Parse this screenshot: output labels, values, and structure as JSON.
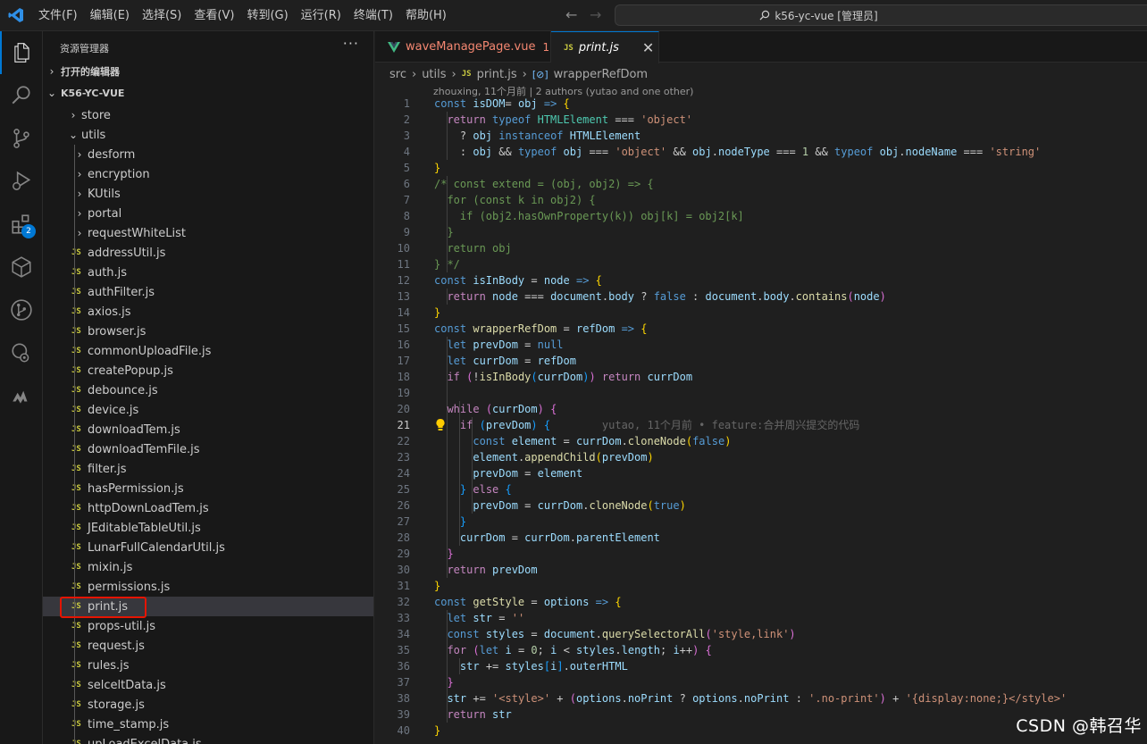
{
  "titlebar": {
    "menus": [
      "文件(F)",
      "编辑(E)",
      "选择(S)",
      "查看(V)",
      "转到(G)",
      "运行(R)",
      "终端(T)",
      "帮助(H)"
    ],
    "search_text": "k56-yc-vue [管理员]"
  },
  "activitybar": {
    "extensions_badge": "2",
    "icons": [
      "explorer-icon",
      "search-icon",
      "source-control-icon",
      "run-debug-icon",
      "extensions-icon",
      "box-icon",
      "git-graph-icon",
      "remote-icon",
      "logo-icon"
    ]
  },
  "sidebar": {
    "title": "资源管理器",
    "more": "···",
    "open_editors": "打开的编辑器",
    "project": "K56-YC-VUE",
    "items": [
      {
        "label": "store",
        "type": "folder",
        "state": "closed",
        "level": 1
      },
      {
        "label": "utils",
        "type": "folder",
        "state": "open",
        "level": 1
      },
      {
        "label": "desform",
        "type": "folder",
        "state": "closed",
        "level": 2
      },
      {
        "label": "encryption",
        "type": "folder",
        "state": "closed",
        "level": 2
      },
      {
        "label": "KUtils",
        "type": "folder",
        "state": "closed",
        "level": 2
      },
      {
        "label": "portal",
        "type": "folder",
        "state": "closed",
        "level": 2
      },
      {
        "label": "requestWhiteList",
        "type": "folder",
        "state": "closed",
        "level": 2
      },
      {
        "label": "addressUtil.js",
        "type": "js",
        "level": 2
      },
      {
        "label": "auth.js",
        "type": "js",
        "level": 2
      },
      {
        "label": "authFilter.js",
        "type": "js",
        "level": 2
      },
      {
        "label": "axios.js",
        "type": "js",
        "level": 2
      },
      {
        "label": "browser.js",
        "type": "js",
        "level": 2
      },
      {
        "label": "commonUploadFile.js",
        "type": "js",
        "level": 2
      },
      {
        "label": "createPopup.js",
        "type": "js",
        "level": 2
      },
      {
        "label": "debounce.js",
        "type": "js",
        "level": 2
      },
      {
        "label": "device.js",
        "type": "js",
        "level": 2
      },
      {
        "label": "downloadTem.js",
        "type": "js",
        "level": 2
      },
      {
        "label": "downloadTemFile.js",
        "type": "js",
        "level": 2
      },
      {
        "label": "filter.js",
        "type": "js",
        "level": 2
      },
      {
        "label": "hasPermission.js",
        "type": "js",
        "level": 2
      },
      {
        "label": "httpDownLoadTem.js",
        "type": "js",
        "level": 2
      },
      {
        "label": "JEditableTableUtil.js",
        "type": "js",
        "level": 2
      },
      {
        "label": "LunarFullCalendarUtil.js",
        "type": "js",
        "level": 2
      },
      {
        "label": "mixin.js",
        "type": "js",
        "level": 2
      },
      {
        "label": "permissions.js",
        "type": "js",
        "level": 2
      },
      {
        "label": "print.js",
        "type": "js",
        "level": 2,
        "selected": true
      },
      {
        "label": "props-util.js",
        "type": "js",
        "level": 2
      },
      {
        "label": "request.js",
        "type": "js",
        "level": 2
      },
      {
        "label": "rules.js",
        "type": "js",
        "level": 2
      },
      {
        "label": "selceltData.js",
        "type": "js",
        "level": 2
      },
      {
        "label": "storage.js",
        "type": "js",
        "level": 2
      },
      {
        "label": "time_stamp.js",
        "type": "js",
        "level": 2
      },
      {
        "label": "upLoadExcelData.js",
        "type": "js",
        "level": 2
      }
    ]
  },
  "tabs": [
    {
      "label": "waveManagePage.vue",
      "modified": "1"
    },
    {
      "label": "print.js",
      "close": "✕"
    }
  ],
  "breadcrumb": {
    "parts": [
      "src",
      "utils",
      "print.js",
      "wrapperRefDom"
    ],
    "sep": "›"
  },
  "codelens": "zhouxing, 11个月前 | 2 authors (yutao and one other)",
  "blame": "yutao, 11个月前 • feature:合并周兴提交的代码",
  "current_line": 21,
  "code_lines": [
    [
      [
        "k",
        "const "
      ],
      [
        "v",
        "isDOM"
      ],
      [
        "",
        "="
      ],
      [
        "v",
        " obj"
      ],
      [
        "",
        " "
      ],
      [
        "k",
        "=>"
      ],
      [
        "",
        " "
      ],
      [
        "y",
        "{"
      ]
    ],
    [
      [
        "",
        "  "
      ],
      [
        "c",
        "return "
      ],
      [
        "k",
        "typeof "
      ],
      [
        "t",
        "HTMLElement"
      ],
      [
        "",
        " === "
      ],
      [
        "s",
        "'object'"
      ]
    ],
    [
      [
        "",
        "    ? "
      ],
      [
        "v",
        "obj"
      ],
      [
        "",
        " "
      ],
      [
        "k",
        "instanceof "
      ],
      [
        "v",
        "HTMLElement"
      ]
    ],
    [
      [
        "",
        "    : "
      ],
      [
        "v",
        "obj"
      ],
      [
        "",
        " && "
      ],
      [
        "k",
        "typeof "
      ],
      [
        "v",
        "obj"
      ],
      [
        "",
        " === "
      ],
      [
        "s",
        "'object'"
      ],
      [
        "",
        " && "
      ],
      [
        "v",
        "obj"
      ],
      [
        "",
        "."
      ],
      [
        "v",
        "nodeType"
      ],
      [
        "",
        " === "
      ],
      [
        "n",
        "1"
      ],
      [
        "",
        " && "
      ],
      [
        "k",
        "typeof "
      ],
      [
        "v",
        "obj"
      ],
      [
        "",
        "."
      ],
      [
        "v",
        "nodeName"
      ],
      [
        "",
        " === "
      ],
      [
        "s",
        "'string'"
      ]
    ],
    [
      [
        "y",
        "}"
      ]
    ],
    [
      [
        "cm",
        "/* const extend = (obj, obj2) => {"
      ]
    ],
    [
      [
        "cm",
        "  for (const k in obj2) {"
      ]
    ],
    [
      [
        "cm",
        "    if (obj2.hasOwnProperty(k)) obj[k] = obj2[k]"
      ]
    ],
    [
      [
        "cm",
        "  }"
      ]
    ],
    [
      [
        "cm",
        "  return obj"
      ]
    ],
    [
      [
        "cm",
        "} */"
      ]
    ],
    [
      [
        "k",
        "const "
      ],
      [
        "v",
        "isInBody"
      ],
      [
        "",
        " = "
      ],
      [
        "v",
        "node"
      ],
      [
        "",
        " "
      ],
      [
        "k",
        "=>"
      ],
      [
        "",
        " "
      ],
      [
        "y",
        "{"
      ]
    ],
    [
      [
        "",
        "  "
      ],
      [
        "c",
        "return "
      ],
      [
        "v",
        "node"
      ],
      [
        "",
        " === "
      ],
      [
        "v",
        "document"
      ],
      [
        "",
        "."
      ],
      [
        "v",
        "body"
      ],
      [
        "",
        " ? "
      ],
      [
        "k",
        "false"
      ],
      [
        "",
        " : "
      ],
      [
        "v",
        "document"
      ],
      [
        "",
        "."
      ],
      [
        "v",
        "body"
      ],
      [
        "",
        "."
      ],
      [
        "f",
        "contains"
      ],
      [
        "p",
        "("
      ],
      [
        "v",
        "node"
      ],
      [
        "p",
        ")"
      ]
    ],
    [
      [
        "y",
        "}"
      ]
    ],
    [
      [
        "k",
        "const "
      ],
      [
        "f",
        "wrapperRefDom"
      ],
      [
        "",
        " = "
      ],
      [
        "v",
        "refDom"
      ],
      [
        "",
        " "
      ],
      [
        "k",
        "=>"
      ],
      [
        "",
        " "
      ],
      [
        "y",
        "{"
      ]
    ],
    [
      [
        "",
        "  "
      ],
      [
        "k",
        "let "
      ],
      [
        "v",
        "prevDom"
      ],
      [
        "",
        " = "
      ],
      [
        "k",
        "null"
      ]
    ],
    [
      [
        "",
        "  "
      ],
      [
        "k",
        "let "
      ],
      [
        "v",
        "currDom"
      ],
      [
        "",
        " = "
      ],
      [
        "v",
        "refDom"
      ]
    ],
    [
      [
        "",
        "  "
      ],
      [
        "c",
        "if "
      ],
      [
        "p",
        "("
      ],
      [
        "",
        "!"
      ],
      [
        "f",
        "isInBody"
      ],
      [
        "b",
        "("
      ],
      [
        "v",
        "currDom"
      ],
      [
        "b",
        ")"
      ],
      [
        "p",
        ")"
      ],
      [
        "",
        " "
      ],
      [
        "c",
        "return "
      ],
      [
        "v",
        "currDom"
      ]
    ],
    [
      [
        "",
        ""
      ]
    ],
    [
      [
        "",
        "  "
      ],
      [
        "c",
        "while "
      ],
      [
        "p",
        "("
      ],
      [
        "v",
        "currDom"
      ],
      [
        "p",
        ")"
      ],
      [
        "",
        " "
      ],
      [
        "p",
        "{"
      ]
    ],
    [
      [
        "",
        "    "
      ],
      [
        "c",
        "if "
      ],
      [
        "b",
        "("
      ],
      [
        "v",
        "prevDom"
      ],
      [
        "b",
        ")"
      ],
      [
        "",
        " "
      ],
      [
        "b",
        "{"
      ]
    ],
    [
      [
        "",
        "      "
      ],
      [
        "k",
        "const "
      ],
      [
        "v",
        "element"
      ],
      [
        "",
        " = "
      ],
      [
        "v",
        "currDom"
      ],
      [
        "",
        "."
      ],
      [
        "f",
        "cloneNode"
      ],
      [
        "y",
        "("
      ],
      [
        "k",
        "false"
      ],
      [
        "y",
        ")"
      ]
    ],
    [
      [
        "",
        "      "
      ],
      [
        "v",
        "element"
      ],
      [
        "",
        "."
      ],
      [
        "f",
        "appendChild"
      ],
      [
        "y",
        "("
      ],
      [
        "v",
        "prevDom"
      ],
      [
        "y",
        ")"
      ]
    ],
    [
      [
        "",
        "      "
      ],
      [
        "v",
        "prevDom"
      ],
      [
        "",
        " = "
      ],
      [
        "v",
        "element"
      ]
    ],
    [
      [
        "",
        "    "
      ],
      [
        "b",
        "}"
      ],
      [
        "",
        " "
      ],
      [
        "c",
        "else "
      ],
      [
        "b",
        "{"
      ]
    ],
    [
      [
        "",
        "      "
      ],
      [
        "v",
        "prevDom"
      ],
      [
        "",
        " = "
      ],
      [
        "v",
        "currDom"
      ],
      [
        "",
        "."
      ],
      [
        "f",
        "cloneNode"
      ],
      [
        "y",
        "("
      ],
      [
        "k",
        "true"
      ],
      [
        "y",
        ")"
      ]
    ],
    [
      [
        "",
        "    "
      ],
      [
        "b",
        "}"
      ]
    ],
    [
      [
        "",
        "    "
      ],
      [
        "v",
        "currDom"
      ],
      [
        "",
        " = "
      ],
      [
        "v",
        "currDom"
      ],
      [
        "",
        "."
      ],
      [
        "v",
        "parentElement"
      ]
    ],
    [
      [
        "",
        "  "
      ],
      [
        "p",
        "}"
      ]
    ],
    [
      [
        "",
        "  "
      ],
      [
        "c",
        "return "
      ],
      [
        "v",
        "prevDom"
      ]
    ],
    [
      [
        "y",
        "}"
      ]
    ],
    [
      [
        "k",
        "const "
      ],
      [
        "f",
        "getStyle"
      ],
      [
        "",
        " = "
      ],
      [
        "v",
        "options"
      ],
      [
        "",
        " "
      ],
      [
        "k",
        "=>"
      ],
      [
        "",
        " "
      ],
      [
        "y",
        "{"
      ]
    ],
    [
      [
        "",
        "  "
      ],
      [
        "k",
        "let "
      ],
      [
        "v",
        "str"
      ],
      [
        "",
        " = "
      ],
      [
        "s",
        "''"
      ]
    ],
    [
      [
        "",
        "  "
      ],
      [
        "k",
        "const "
      ],
      [
        "v",
        "styles"
      ],
      [
        "",
        " = "
      ],
      [
        "v",
        "document"
      ],
      [
        "",
        "."
      ],
      [
        "f",
        "querySelectorAll"
      ],
      [
        "p",
        "("
      ],
      [
        "s",
        "'style,link'"
      ],
      [
        "p",
        ")"
      ]
    ],
    [
      [
        "",
        "  "
      ],
      [
        "c",
        "for "
      ],
      [
        "p",
        "("
      ],
      [
        "k",
        "let "
      ],
      [
        "v",
        "i"
      ],
      [
        "",
        " = "
      ],
      [
        "n",
        "0"
      ],
      [
        "",
        "; "
      ],
      [
        "v",
        "i"
      ],
      [
        "",
        " < "
      ],
      [
        "v",
        "styles"
      ],
      [
        "",
        "."
      ],
      [
        "v",
        "length"
      ],
      [
        "",
        "; "
      ],
      [
        "v",
        "i"
      ],
      [
        "",
        "++"
      ],
      [
        "p",
        ")"
      ],
      [
        "",
        " "
      ],
      [
        "p",
        "{"
      ]
    ],
    [
      [
        "",
        "    "
      ],
      [
        "v",
        "str"
      ],
      [
        "",
        " += "
      ],
      [
        "v",
        "styles"
      ],
      [
        "b",
        "["
      ],
      [
        "v",
        "i"
      ],
      [
        "b",
        "]"
      ],
      [
        "",
        "."
      ],
      [
        "v",
        "outerHTML"
      ]
    ],
    [
      [
        "",
        "  "
      ],
      [
        "p",
        "}"
      ]
    ],
    [
      [
        "",
        "  "
      ],
      [
        "v",
        "str"
      ],
      [
        "",
        " += "
      ],
      [
        "s",
        "'<style>'"
      ],
      [
        "",
        " + "
      ],
      [
        "p",
        "("
      ],
      [
        "v",
        "options"
      ],
      [
        "",
        "."
      ],
      [
        "v",
        "noPrint"
      ],
      [
        "",
        " ? "
      ],
      [
        "v",
        "options"
      ],
      [
        "",
        "."
      ],
      [
        "v",
        "noPrint"
      ],
      [
        "",
        " : "
      ],
      [
        "s",
        "'.no-print'"
      ],
      [
        "p",
        ")"
      ],
      [
        "",
        " + "
      ],
      [
        "s",
        "'{display:none;}</style>'"
      ]
    ],
    [
      [
        "",
        "  "
      ],
      [
        "c",
        "return "
      ],
      [
        "v",
        "str"
      ]
    ],
    [
      [
        "y",
        "}"
      ]
    ]
  ],
  "watermark": "CSDN @韩召华"
}
